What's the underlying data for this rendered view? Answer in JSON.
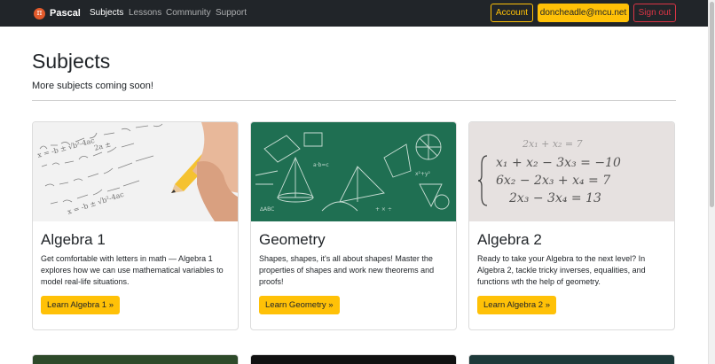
{
  "brand": {
    "logo": "π",
    "name": "Pascal"
  },
  "nav": {
    "subjects": "Subjects",
    "lessons": "Lessons",
    "community": "Community",
    "support": "Support"
  },
  "account": {
    "account_label": "Account",
    "email": "doncheadle@mcu.net",
    "signout": "Sign out"
  },
  "header": {
    "title": "Subjects",
    "lead": "More subjects coming soon!"
  },
  "cards": [
    {
      "title": "Algebra 1",
      "text": "Get comfortable with letters in math — Algebra 1 explores how we can use mathematical variables to model real-life situations.",
      "button": "Learn Algebra 1 »"
    },
    {
      "title": "Geometry",
      "text": "Shapes, shapes, it's all about shapes! Master the properties of shapes and work new theorems and proofs!",
      "button": "Learn Geometry »"
    },
    {
      "title": "Algebra 2",
      "text": "Ready to take your Algebra to the next level? In Algebra 2, tackle tricky inverses, equalities, and functions wth the help of geometry.",
      "button": "Learn Algebra 2 »"
    }
  ],
  "colors": {
    "nav_bg": "#212529",
    "warning": "#ffc107",
    "danger": "#dc3545",
    "brand": "#e25a2b"
  },
  "icons": {
    "brand": "pi-logo-icon"
  }
}
